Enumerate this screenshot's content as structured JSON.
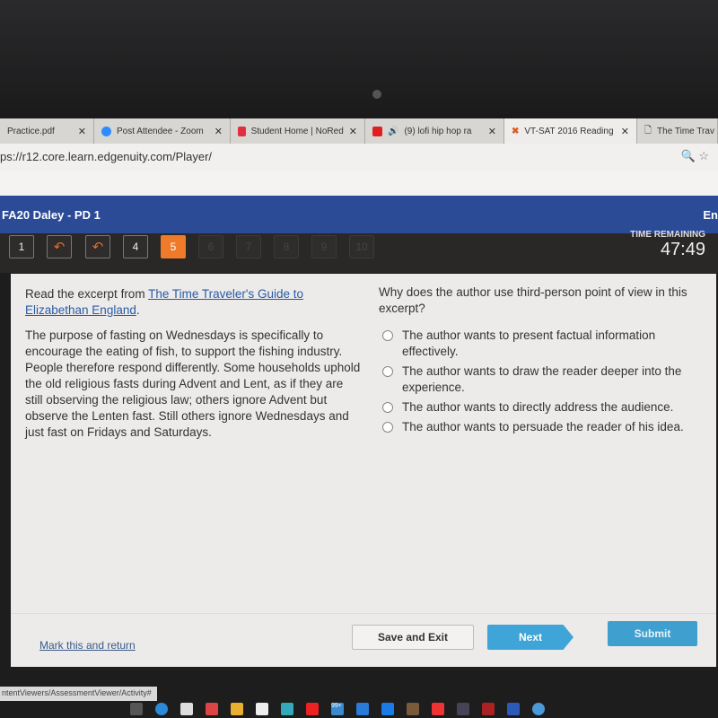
{
  "browser": {
    "tabs": [
      {
        "title": "Practice.pdf",
        "color": "#999999"
      },
      {
        "title": "Post Attendee - Zoom",
        "color": "#2d8cff"
      },
      {
        "title": "Student Home | NoRed",
        "color": "#e03040"
      },
      {
        "title": "(9) lofi hip hop ra",
        "color": "#e02020"
      },
      {
        "title": "VT-SAT 2016 Reading",
        "color": "#e05a20"
      },
      {
        "title": "The Time Trav",
        "color": "#cccccc"
      }
    ],
    "url": "ps://r12.core.learn.edgenuity.com/Player/",
    "status_url": "ntentViewers/AssessmentViewer/Activity#"
  },
  "header": {
    "course": "FA20 Daley - PD 1",
    "right": "En"
  },
  "nav": {
    "buttons": [
      {
        "label": "1",
        "state": "done"
      },
      {
        "label": "↶",
        "state": "flag"
      },
      {
        "label": "↶",
        "state": "flag"
      },
      {
        "label": "4",
        "state": "done"
      },
      {
        "label": "5",
        "state": "current"
      },
      {
        "label": "6",
        "state": "disabled"
      },
      {
        "label": "7",
        "state": "disabled"
      },
      {
        "label": "8",
        "state": "disabled"
      },
      {
        "label": "9",
        "state": "disabled"
      },
      {
        "label": "10",
        "state": "disabled"
      }
    ],
    "time_label": "TIME REMAINING",
    "time": "47:49"
  },
  "passage": {
    "intro": "Read the excerpt from ",
    "title": "The Time Traveler's Guide to Elizabethan England",
    "intro_end": ".",
    "text": "The purpose of fasting on Wednesdays is specifically to encourage the eating of fish, to support the fishing industry. People therefore respond differently. Some households uphold the old religious fasts during Advent and Lent, as if they are still observing the religious law; others ignore Advent but observe the Lenten fast. Still others ignore Wednesdays and just fast on Fridays and Saturdays."
  },
  "question": {
    "prompt": "Why does the author use third-person point of view in this excerpt?",
    "options": [
      "The author wants to present factual information effectively.",
      "The author wants to draw the reader deeper into the experience.",
      "The author wants to directly address the audience.",
      "The author wants to persuade the reader of his idea."
    ]
  },
  "footer": {
    "mark": "Mark this and return",
    "save": "Save and Exit",
    "next": "Next",
    "submit": "Submit"
  },
  "taskbar": {
    "badge": "99+"
  }
}
